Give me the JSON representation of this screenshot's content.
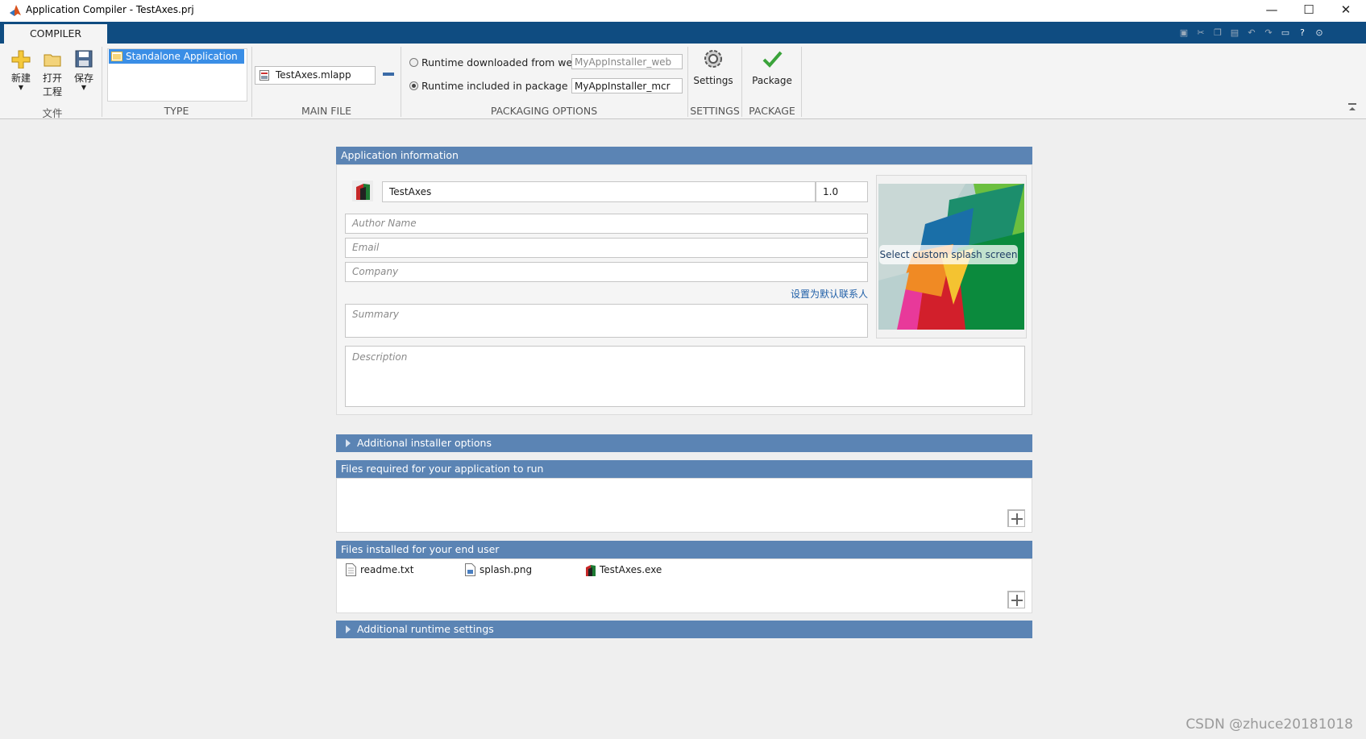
{
  "window": {
    "title": "Application Compiler - TestAxes.prj",
    "minimize_glyph": "—",
    "maximize_glyph": "☐",
    "close_glyph": "✕"
  },
  "ribbon": {
    "tab_label": "COMPILER",
    "file_group": {
      "label": "文件",
      "new_label": "新建",
      "open_label_line1": "打开",
      "open_label_line2": "工程",
      "save_label": "保存"
    },
    "type_group": {
      "label": "TYPE",
      "selected": "Standalone Application"
    },
    "main_file_group": {
      "label": "MAIN FILE",
      "file": "TestAxes.mlapp"
    },
    "packaging_group": {
      "label": "PACKAGING OPTIONS",
      "web_option_label": "Runtime downloaded from web",
      "web_option_value": "MyAppInstaller_web",
      "package_option_label": "Runtime included in package",
      "package_option_value": "MyAppInstaller_mcr"
    },
    "settings_group": {
      "label": "SETTINGS",
      "button_label": "Settings"
    },
    "package_group": {
      "label": "PACKAGE",
      "button_label": "Package"
    }
  },
  "app_info": {
    "header": "Application information",
    "app_name": "TestAxes",
    "version": "1.0",
    "author_placeholder": "Author Name",
    "email_placeholder": "Email",
    "company_placeholder": "Company",
    "default_contact_link": "设置为默认联系人",
    "summary_placeholder": "Summary",
    "description_placeholder": "Description",
    "splash_button": "Select custom splash screen"
  },
  "sections": {
    "additional_installer": "Additional installer options",
    "files_required": "Files required for your application to run",
    "files_installed": "Files installed for your end user",
    "additional_runtime": "Additional runtime settings"
  },
  "installed_files": [
    "readme.txt",
    "splash.png",
    "TestAxes.exe"
  ],
  "colors": {
    "tab_strip": "#0f4c81",
    "panel_header": "#5b84b4",
    "selection": "#3a8ee6",
    "link": "#1f5fa8"
  },
  "watermark": "CSDN @zhuce20181018"
}
